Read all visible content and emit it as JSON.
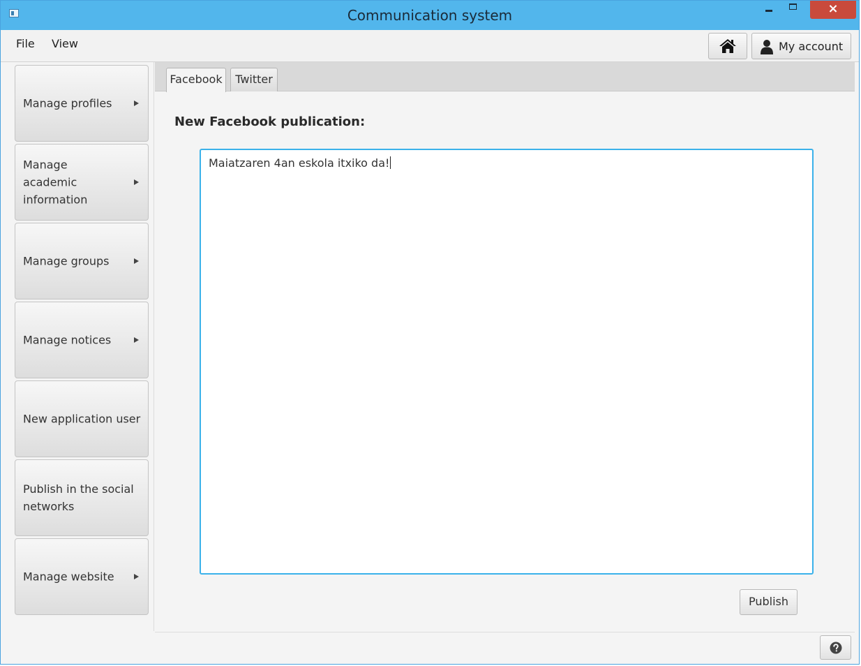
{
  "window": {
    "title": "Communication system",
    "close_glyph": "×"
  },
  "menubar": {
    "items": [
      "File",
      "View"
    ]
  },
  "toolbar": {
    "home_icon": "home-icon",
    "account_label": "My account",
    "account_icon": "user-icon"
  },
  "sidebar": {
    "items": [
      {
        "label": "Manage profiles",
        "has_submenu": true
      },
      {
        "label": "Manage academic information",
        "has_submenu": true
      },
      {
        "label": "Manage groups",
        "has_submenu": true
      },
      {
        "label": "Manage notices",
        "has_submenu": true
      },
      {
        "label": "New application user",
        "has_submenu": false
      },
      {
        "label": "Publish in the social networks",
        "has_submenu": false
      },
      {
        "label": "Manage website",
        "has_submenu": true
      }
    ]
  },
  "tabs": [
    {
      "label": "Facebook",
      "selected": true
    },
    {
      "label": "Twitter",
      "selected": false
    }
  ],
  "publication": {
    "heading": "New Facebook publication:",
    "text": "Maiatzaren 4an eskola itxiko da!",
    "publish_label": "Publish"
  },
  "footer": {
    "help_icon": "help-icon"
  },
  "colors": {
    "titlebar": "#52b6ec",
    "close": "#c94a3c",
    "focus_border": "#3ab1ea"
  }
}
